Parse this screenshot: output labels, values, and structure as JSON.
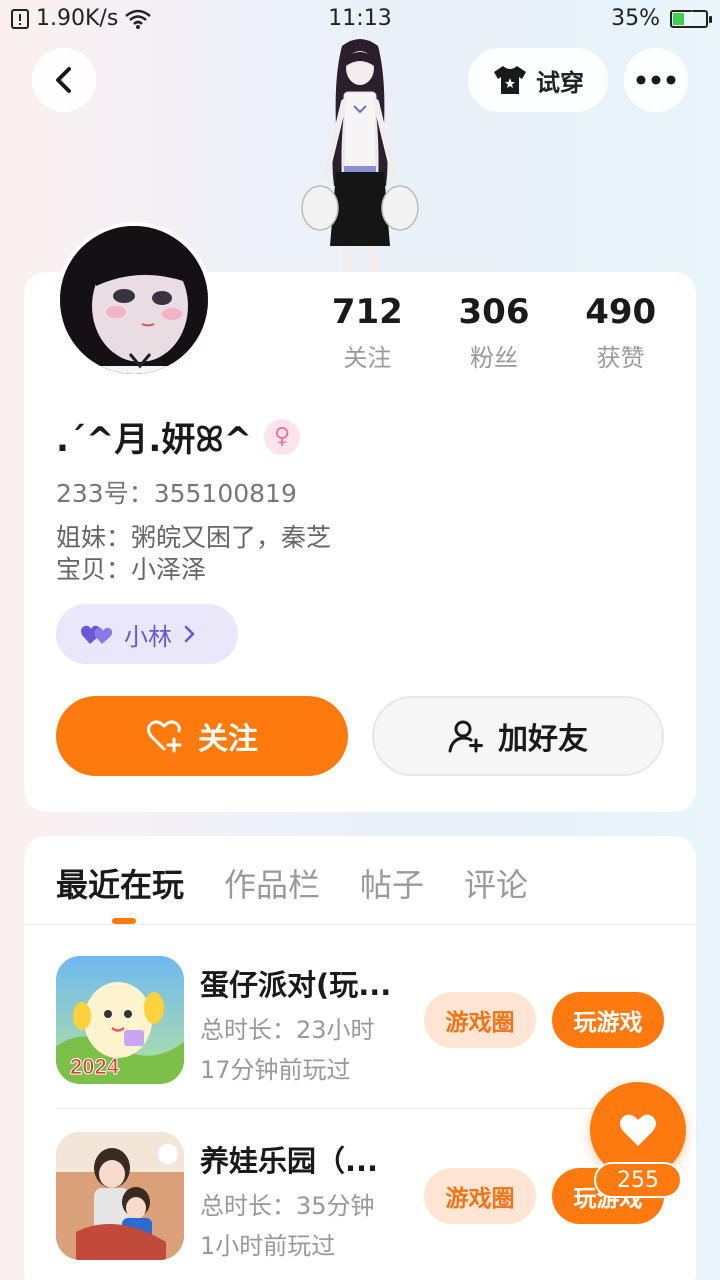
{
  "status_bar": {
    "network_speed": "1.90K/s",
    "time": "11:13",
    "battery": "35%",
    "battery_level": 0.35
  },
  "header": {
    "try_on_label": "试穿"
  },
  "profile": {
    "stats": [
      {
        "value": "712",
        "label": "关注"
      },
      {
        "value": "306",
        "label": "粉丝"
      },
      {
        "value": "490",
        "label": "获赞"
      }
    ],
    "name": ".ˊ^月.妍ꕤ^",
    "uid": "233号：355100819",
    "bio_line1": "姐妹：粥皖又困了，秦芝",
    "bio_line2": "宝贝：小泽泽",
    "tag_label": "小林",
    "follow_label": "关注",
    "add_friend_label": "加好友"
  },
  "tabs": [
    {
      "label": "最近在玩",
      "active": true
    },
    {
      "label": "作品栏",
      "active": false
    },
    {
      "label": "帖子",
      "active": false
    },
    {
      "label": "评论",
      "active": false
    }
  ],
  "games": [
    {
      "title": "蛋仔派对(玩...",
      "duration": "总时长：23小时",
      "last_played": "17分钟前玩过",
      "circle_label": "游戏圈",
      "play_label": "玩游戏"
    },
    {
      "title": "养娃乐园（...",
      "duration": "总时长：35分钟",
      "last_played": "1小时前玩过",
      "circle_label": "游戏圈",
      "play_label": "玩游戏"
    }
  ],
  "game_icon_text": "2024",
  "like": {
    "count": "255"
  },
  "colors": {
    "accent": "#ff7a0e",
    "tag_bg": "#ebe7fb",
    "tag_text": "#6a56d6"
  }
}
